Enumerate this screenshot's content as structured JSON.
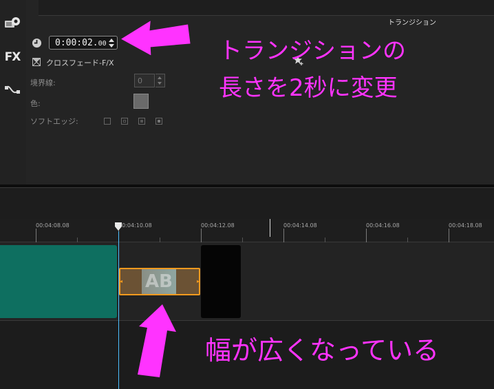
{
  "options_panel": {
    "title": "トランジション",
    "duration": {
      "main": "0:00:02",
      "frames": "00"
    },
    "transition_name": "クロスフェード-F/X",
    "border_label": "境界線:",
    "border_value": "0",
    "color_label": "色:",
    "soft_edge_label": "ソフトエッジ:"
  },
  "tool_strip": {
    "fx_label": "FX"
  },
  "timeline": {
    "ruler_labels": [
      "00:04:08.08",
      "00:04:10.08",
      "00:04:12.08",
      "00:04:14.08",
      "00:04:16.08",
      "00:04:18.08"
    ],
    "transition_thumb_text": "AB"
  },
  "annotations": {
    "top_line1": "トランジションの",
    "top_line2": "長さを2秒に変更",
    "bottom": "幅が広くなっている"
  },
  "colors": {
    "annotation": "#ff33ff",
    "clip_teal": "#0e6f60",
    "transition_border": "#f39a1e",
    "playhead": "#4ec0ff"
  }
}
